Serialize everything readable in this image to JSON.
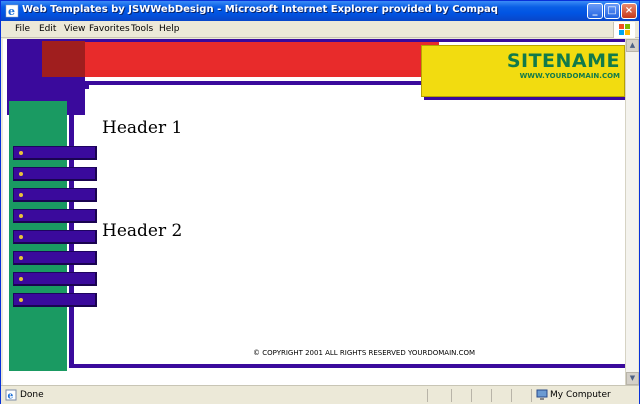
{
  "window": {
    "title": "Web Templates by JSWWebDesign - Microsoft Internet Explorer provided by Compaq",
    "controls": {
      "minimize": "_",
      "maximize": "□",
      "close": "×"
    }
  },
  "menubar": {
    "items": [
      "File",
      "Edit",
      "View",
      "Favorites",
      "Tools",
      "Help"
    ]
  },
  "page": {
    "site_name": "SITENAME",
    "site_url": "WWW.YOURDOMAIN.COM",
    "header1": "Header 1",
    "header2": "Header 2",
    "copyright": "© COPYRIGHT 2001 ALL RIGHTS RESERVED YOURDOMAIN.COM",
    "nav_buttons": [
      "",
      "",
      "",
      "",
      "",
      "",
      "",
      ""
    ],
    "colors": {
      "purple": "#3a0a9c",
      "red": "#e82b2b",
      "dark_red": "#a01e1e",
      "green": "#1a9a62",
      "yellow": "#f2dc10",
      "sitename_text": "#127a4a"
    }
  },
  "statusbar": {
    "status": "Done",
    "zone": "My Computer"
  }
}
